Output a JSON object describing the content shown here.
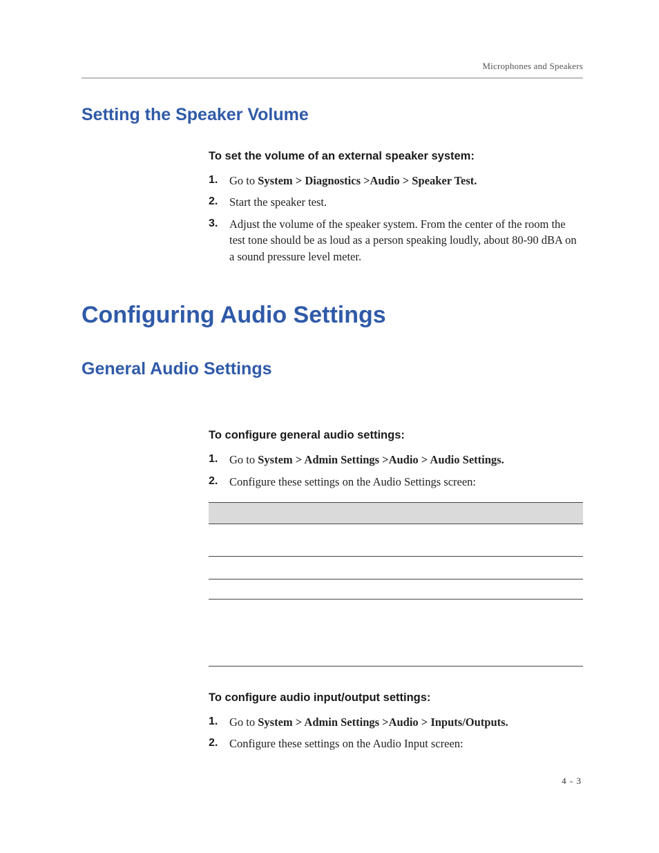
{
  "header": {
    "running_title": "Microphones and Speakers"
  },
  "section1": {
    "title": "Setting the Speaker Volume",
    "lead": "To set the volume of an external speaker system:",
    "steps": [
      {
        "prefix": "Go to ",
        "bold": "System > Diagnostics >Audio > Speaker Test.",
        "suffix": ""
      },
      {
        "prefix": "Start the speaker test.",
        "bold": "",
        "suffix": ""
      },
      {
        "prefix": "Adjust the volume of the speaker system. From the center of the room the test tone should be as loud as a person speaking loudly, about 80-90 dBA on a sound pressure level meter.",
        "bold": "",
        "suffix": ""
      }
    ]
  },
  "section2": {
    "title": "Configuring Audio Settings",
    "sub1": {
      "title": "General Audio Settings",
      "blockA": {
        "lead": "To configure general audio settings:",
        "steps": [
          {
            "prefix": "Go to ",
            "bold": "System > Admin Settings >Audio > Audio Settings.",
            "suffix": ""
          },
          {
            "prefix": "Configure these settings on the Audio Settings screen:",
            "bold": "",
            "suffix": ""
          }
        ],
        "table": {
          "header": [
            "",
            ""
          ],
          "rows": [
            [
              "",
              ""
            ],
            [
              "",
              ""
            ],
            [
              "",
              ""
            ],
            [
              "",
              ""
            ]
          ]
        }
      },
      "blockB": {
        "lead": "To configure audio input/output settings:",
        "steps": [
          {
            "prefix": "Go to ",
            "bold": "System > Admin Settings >Audio > Inputs/Outputs.",
            "suffix": ""
          },
          {
            "prefix": "Configure these settings on the Audio Input screen:",
            "bold": "",
            "suffix": ""
          }
        ]
      }
    }
  },
  "footer": {
    "page_number": "4 - 3"
  }
}
